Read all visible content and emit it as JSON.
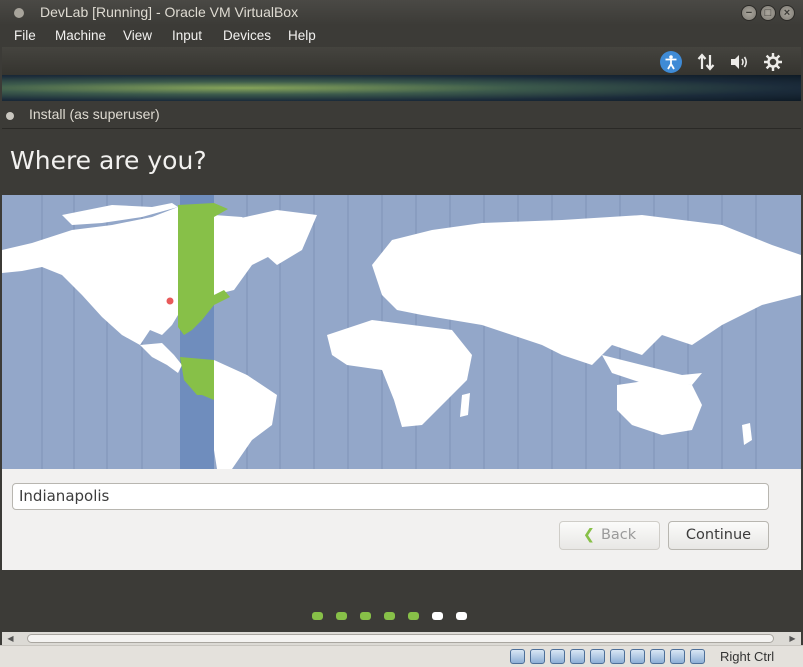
{
  "window": {
    "title": "DevLab [Running] - Oracle VM VirtualBox"
  },
  "menu": {
    "items": [
      "File",
      "Machine",
      "View",
      "Input",
      "Devices",
      "Help"
    ]
  },
  "guest_panel": {
    "icons": [
      "accessibility-icon",
      "network-icon",
      "volume-icon",
      "settings-gear-icon"
    ]
  },
  "installer": {
    "window_title": "Install (as superuser)",
    "heading": "Where are you?",
    "timezone_city_value": "Indianapolis",
    "back_label": "Back",
    "continue_label": "Continue",
    "back_arrow": "❮",
    "step_dots": [
      {
        "state": "done",
        "color": "#87c048"
      },
      {
        "state": "done",
        "color": "#87c048"
      },
      {
        "state": "done",
        "color": "#87c048"
      },
      {
        "state": "done",
        "color": "#87c048"
      },
      {
        "state": "done",
        "color": "#87c048"
      },
      {
        "state": "pending",
        "color": "#ffffff"
      },
      {
        "state": "pending",
        "color": "#ffffff"
      }
    ]
  },
  "statusbar": {
    "host_key": "Right Ctrl",
    "icons": [
      "hard-disk-icon",
      "optical-disk-icon",
      "audio-icon",
      "usb-icon",
      "shared-folder-icon",
      "display-icon",
      "video-capture-icon",
      "cpu-icon",
      "network-activity-icon",
      "mouse-integration-icon"
    ]
  },
  "colors": {
    "accent_green": "#87c048",
    "map_ocean": "#93a7c9",
    "map_selected_zone": "#6f8dbd"
  }
}
